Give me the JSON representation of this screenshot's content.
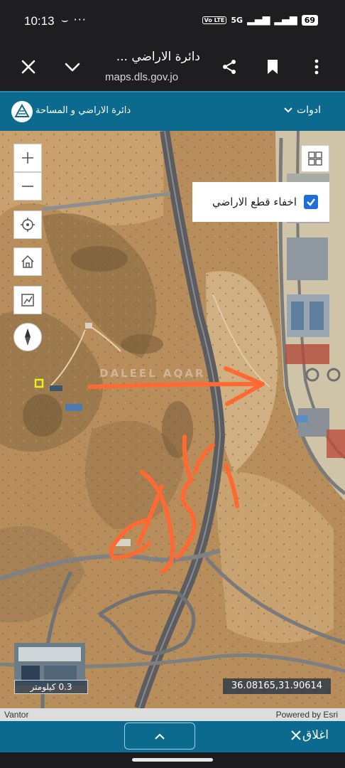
{
  "status_bar": {
    "time": "10:13",
    "extras": "⌣ ···",
    "volte": "Vo LTE",
    "network": "5G",
    "battery": "69"
  },
  "browser": {
    "title": "دائرة الاراضي ...",
    "url": "maps.dls.gov.jo"
  },
  "site": {
    "name": "دائرة الاراضي و المساحة",
    "tools_label": "ادوات"
  },
  "map": {
    "toggle_label": "اخفاء قطع الاراضي",
    "toggle_checked": true,
    "scale_label": "0.3 كيلومتر",
    "coordinates": "36.08165,31.90614",
    "watermark": "DALEEL AQAR"
  },
  "attribution": {
    "left": "Vantor",
    "right": "Powered by Esri"
  },
  "bottom_panel": {
    "close_label": "اغلاق"
  },
  "colors": {
    "header": "#0c6a8e",
    "annotation": "#ff6a33",
    "checkbox": "#1e6fd9"
  }
}
